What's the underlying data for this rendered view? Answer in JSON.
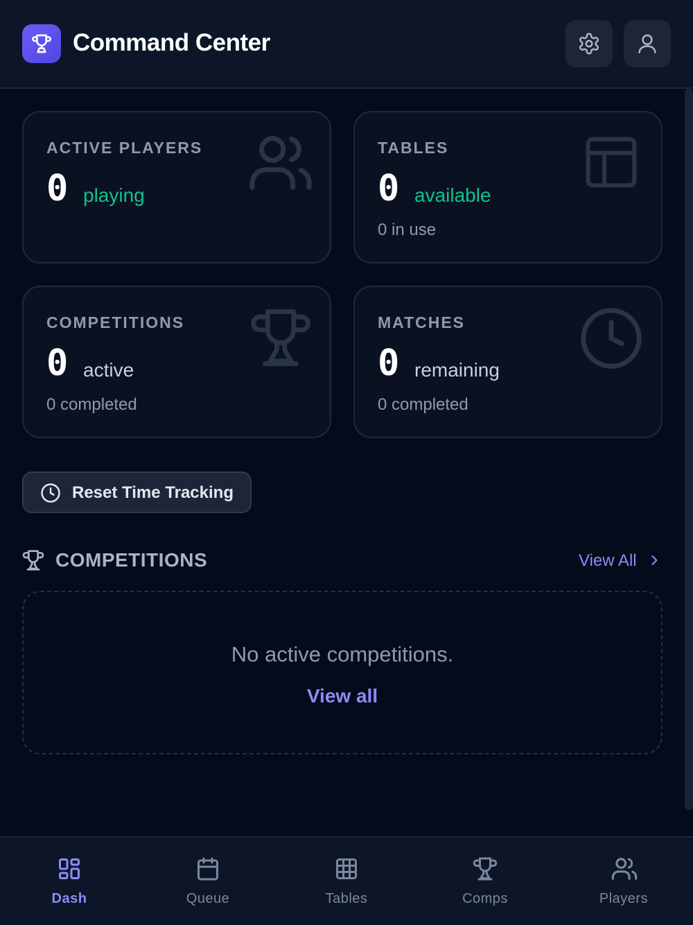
{
  "header": {
    "title": "Command Center",
    "logo_icon": "trophy-icon",
    "settings_icon": "gear-icon",
    "profile_icon": "user-icon"
  },
  "stats": {
    "active_players": {
      "label": "ACTIVE PLAYERS",
      "value": "0",
      "suffix": "playing",
      "icon": "users-icon"
    },
    "tables": {
      "label": "TABLES",
      "value": "0",
      "suffix": "available",
      "sub": "0 in use",
      "icon": "layout-icon"
    },
    "competitions": {
      "label": "COMPETITIONS",
      "value": "0",
      "suffix": "active",
      "sub": "0 completed",
      "icon": "trophy-icon"
    },
    "matches": {
      "label": "MATCHES",
      "value": "0",
      "suffix": "remaining",
      "sub": "0 completed",
      "icon": "clock-icon"
    }
  },
  "reset_button": {
    "label": "Reset Time Tracking",
    "icon": "clock-icon"
  },
  "competitions_section": {
    "title": "COMPETITIONS",
    "view_all": "View All",
    "empty_text": "No active competitions.",
    "empty_link": "View all"
  },
  "bottom_nav": {
    "items": [
      {
        "label": "Dash",
        "icon": "dashboard-icon",
        "active": true
      },
      {
        "label": "Queue",
        "icon": "calendar-icon",
        "active": false
      },
      {
        "label": "Tables",
        "icon": "grid-icon",
        "active": false
      },
      {
        "label": "Comps",
        "icon": "trophy-icon",
        "active": false
      },
      {
        "label": "Players",
        "icon": "users-icon",
        "active": false
      }
    ]
  },
  "colors": {
    "background": "#050b1a",
    "accent": "#8b8cf8",
    "brand": "#5b4ff0",
    "success": "#10c38a"
  }
}
